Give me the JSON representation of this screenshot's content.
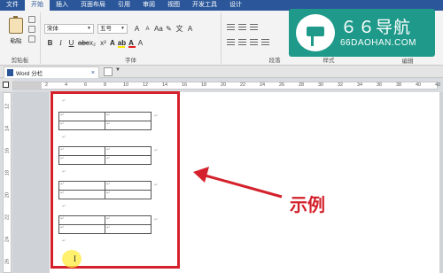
{
  "menu": {
    "items": [
      "文件",
      "开始",
      "插入",
      "页面布局",
      "引用",
      "审阅",
      "视图",
      "开发工具",
      "设计"
    ]
  },
  "ribbon": {
    "paste_label": "粘贴",
    "clipboard_label": "剪贴板",
    "font_name": "宋体",
    "font_size": "五号",
    "font_group_label": "字体",
    "paragraph_label": "段落",
    "styles_label": "样式",
    "editing_label": "编辑"
  },
  "tab": {
    "title": "Word 分栏",
    "close": "×"
  },
  "ruler": {
    "h_ticks": [
      "2",
      "4",
      "6",
      "8",
      "10",
      "12",
      "14",
      "16",
      "18",
      "20",
      "22",
      "24",
      "26",
      "28",
      "30",
      "32",
      "34",
      "36",
      "38",
      "40",
      "42"
    ],
    "v_ticks": [
      "12",
      "14",
      "16",
      "18",
      "20",
      "22",
      "24",
      "26"
    ]
  },
  "logo": {
    "title": "６６导航",
    "subtitle": "66DAOHAN.COM"
  },
  "annotation": {
    "callout": "示例"
  },
  "document": {
    "para_mark": "↵"
  },
  "colors": {
    "title_bar": "#2b579a",
    "highlight_border": "#d4212b",
    "logo_bg": "#1f9a8a"
  }
}
